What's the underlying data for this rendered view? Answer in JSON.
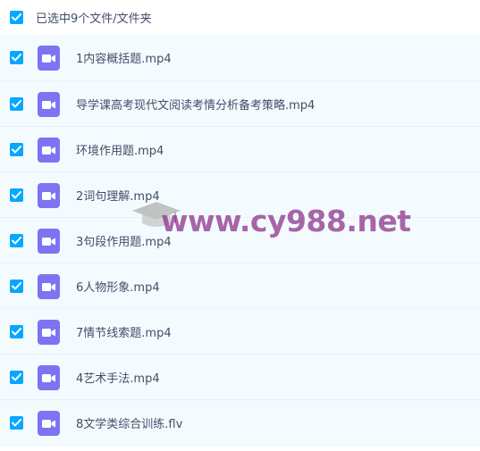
{
  "header": {
    "checked": true,
    "label": "已选中9个文件/文件夹"
  },
  "files": [
    {
      "name": "1内容概括题.mp4",
      "checked": true,
      "icon": "video-file-icon"
    },
    {
      "name": "导学课高考现代文阅读考情分析备考策略.mp4",
      "checked": true,
      "icon": "video-file-icon"
    },
    {
      "name": "环境作用题.mp4",
      "checked": true,
      "icon": "video-file-icon"
    },
    {
      "name": "2词句理解.mp4",
      "checked": true,
      "icon": "video-file-icon"
    },
    {
      "name": "3句段作用题.mp4",
      "checked": true,
      "icon": "video-file-icon"
    },
    {
      "name": "6人物形象.mp4",
      "checked": true,
      "icon": "video-file-icon"
    },
    {
      "name": "7情节线索题.mp4",
      "checked": true,
      "icon": "video-file-icon"
    },
    {
      "name": "4艺术手法.mp4",
      "checked": true,
      "icon": "video-file-icon"
    },
    {
      "name": "8文学类综合训练.flv",
      "checked": true,
      "icon": "video-file-icon"
    }
  ],
  "watermark": {
    "text": "www.cy988.net"
  },
  "colors": {
    "accent": "#06a7ff",
    "row_bg": "#f4fbff",
    "file_icon": "#7c74f3",
    "text": "#424e67",
    "watermark": "#8a2c86"
  }
}
